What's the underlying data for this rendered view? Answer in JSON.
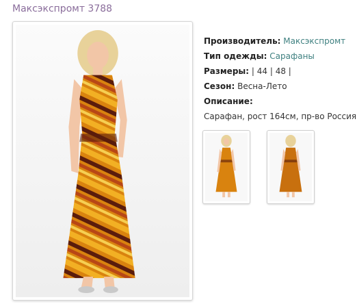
{
  "product": {
    "title": "Максэкспромт 3788"
  },
  "details": {
    "manufacturer_label": "Производитель:",
    "manufacturer_value": "Максэкспромт",
    "type_label": "Тип одежды:",
    "type_value": "Сарафаны",
    "sizes_label": "Размеры:",
    "sizes_value": "| 44 | 48 |",
    "season_label": "Сезон:",
    "season_value": "Весна-Лето",
    "description_label": "Описание:",
    "description_value": "Сарафан, рост 164см, пр-во Россия"
  },
  "colors": {
    "title": "#8a6d9b",
    "link": "#3f8080",
    "dress_primary": "#d9830f",
    "dress_dark": "#5a1c0c",
    "hair": "#e8d29a"
  }
}
